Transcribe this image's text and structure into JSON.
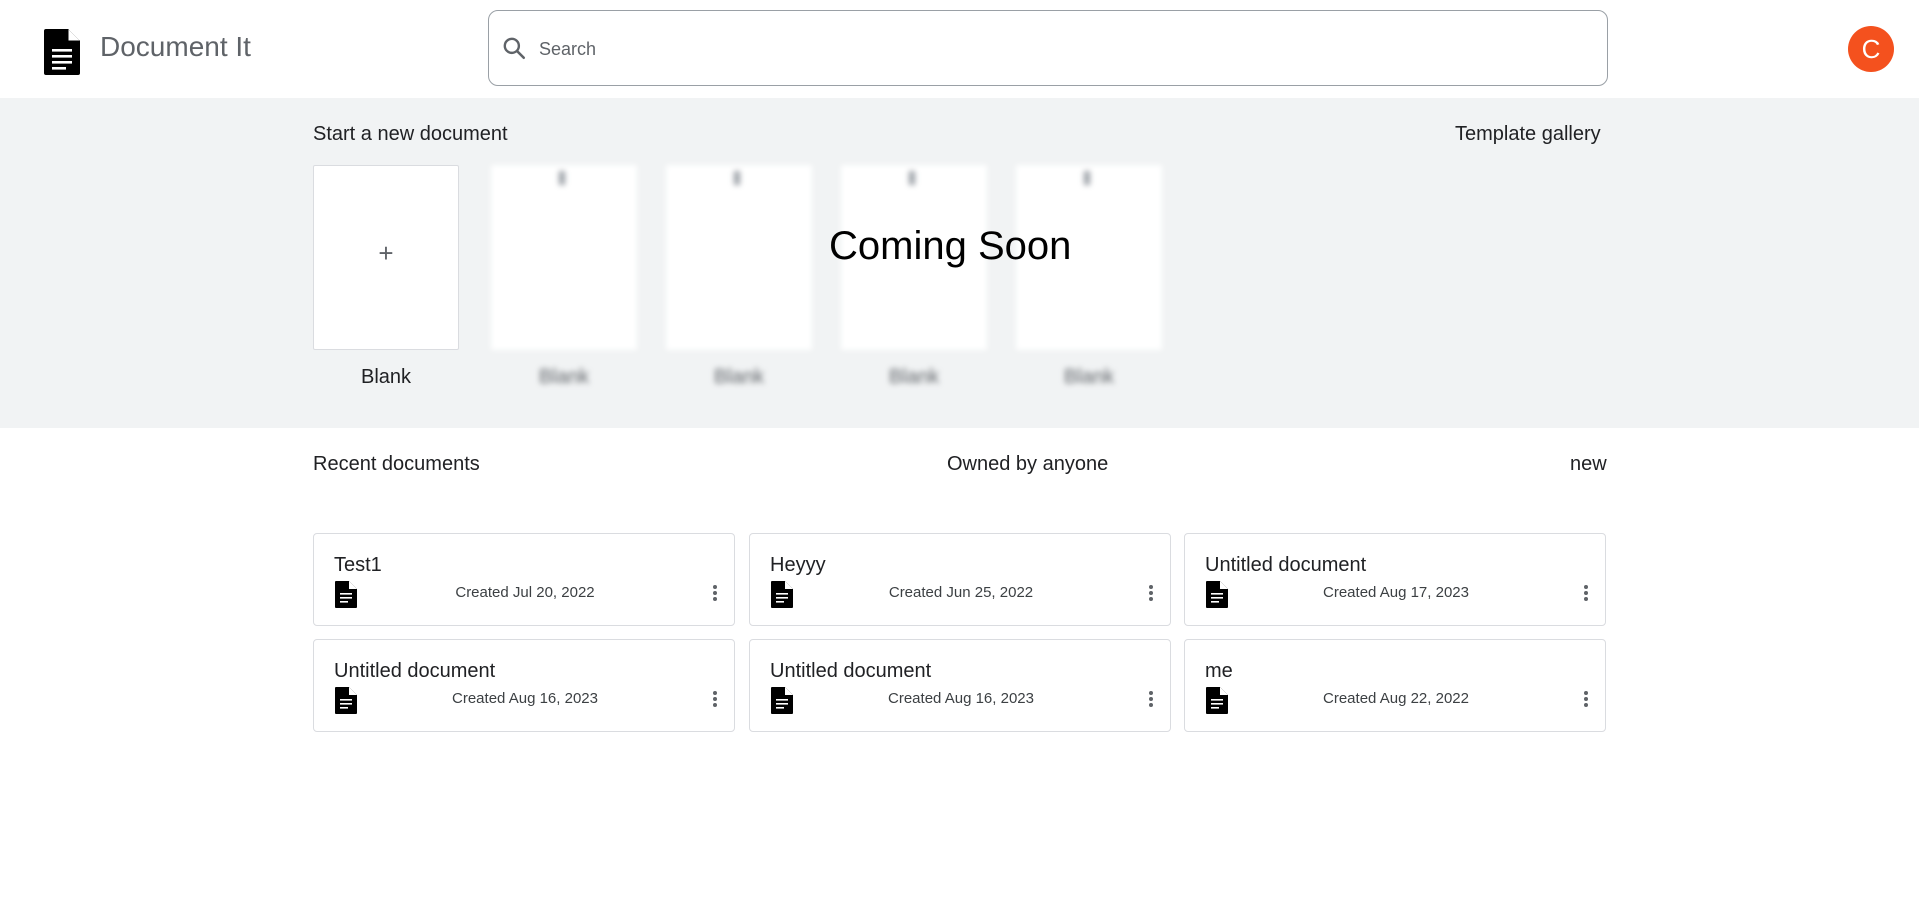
{
  "header": {
    "app_title": "Document It",
    "search_placeholder": "Search",
    "avatar_letter": "C",
    "avatar_color": "#f4511e"
  },
  "templates": {
    "title": "Start a new document",
    "gallery_link": "Template gallery",
    "blank_label": "Blank",
    "blurred_labels": [
      "Blank",
      "Blank",
      "Blank",
      "Blank"
    ],
    "coming_soon": "Coming Soon"
  },
  "recent": {
    "title": "Recent documents",
    "owner_filter": "Owned by anyone",
    "sort": "new",
    "documents": [
      {
        "title": "Test1",
        "date": "Created Jul 20, 2022"
      },
      {
        "title": "Heyyy",
        "date": "Created Jun 25, 2022"
      },
      {
        "title": "Untitled document",
        "date": "Created Aug 17, 2023"
      },
      {
        "title": "Untitled document",
        "date": "Created Aug 16, 2023"
      },
      {
        "title": "Untitled document",
        "date": "Created Aug 16, 2023"
      },
      {
        "title": "me",
        "date": "Created Aug 22, 2022"
      }
    ]
  },
  "icons": {
    "logo": "document-icon",
    "search": "search-icon",
    "doc": "doc-file-icon",
    "menu": "more-vert-icon"
  }
}
